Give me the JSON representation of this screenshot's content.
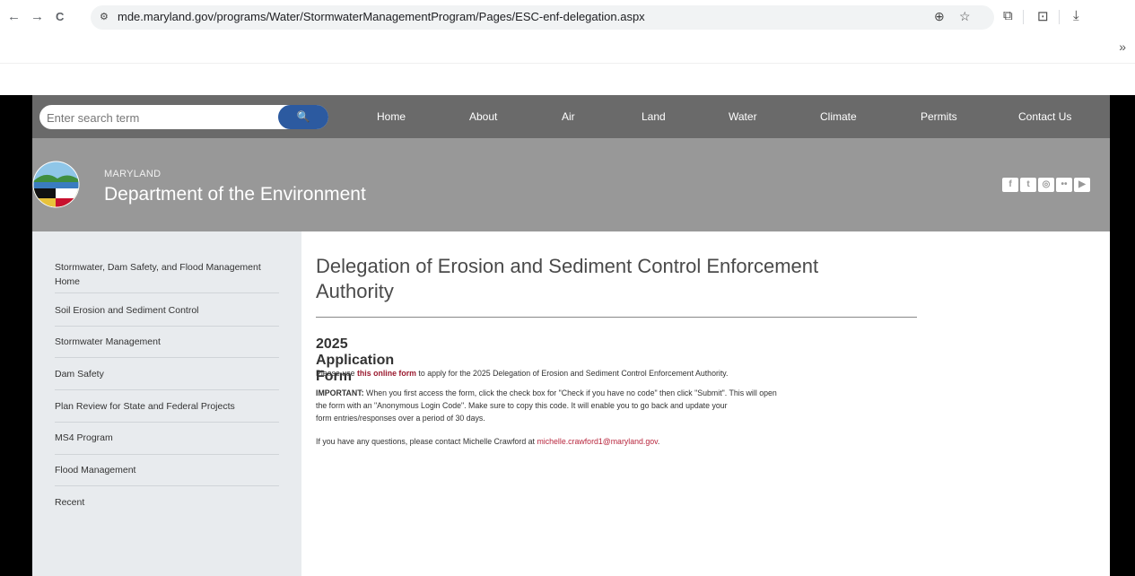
{
  "browser": {
    "url": "mde.maryland.gov/programs/Water/StormwaterManagementProgram/Pages/ESC-enf-delegation.aspx",
    "back_icon": "←",
    "forward_icon": "→",
    "reload_icon": "C",
    "site_info_icon": "⚙",
    "zoom_icon": "⊕",
    "star_icon": "☆",
    "extensions_icon": "⧉",
    "reading_icon": "⊡",
    "download_icon": "⤓",
    "bookmarks_chevron": "»"
  },
  "site_nav": {
    "search_placeholder": "Enter search term",
    "search_icon": "🔍",
    "links": [
      "Home",
      "About",
      "Air",
      "Land",
      "Water",
      "Climate",
      "Permits",
      "Contact Us"
    ]
  },
  "banner": {
    "state": "MARYLAND",
    "department": "Department of the Environment",
    "social": [
      "f",
      "t",
      "◎",
      "••",
      "▶"
    ]
  },
  "sidebar": {
    "items": [
      "Stormwater, Dam Safety, and Flood Management Home",
      "Soil Erosion and Sediment Control",
      "Stormwater Management",
      "Dam Safety",
      "Plan Review for State and Federal Projects",
      "MS4 Program",
      "Flood Management",
      "Recent"
    ]
  },
  "main": {
    "title": "Delegation of Erosion and Sediment Control Enforcement Authority",
    "subtitle": "2025 Application Form",
    "p1_before": "Please use ",
    "p1_link": "this online form",
    "p1_after": " to apply for the 2025 Delegation of Erosion and Sediment Control Enforcement Authority.",
    "important_label": "IMPORTANT:",
    "important_line1": " When you first access the form, click the check box for \"Check if you have no code\" then click \"Submit\".  This will open",
    "important_line2": "the form with an \"Anonymous Login Code\".  Make sure to copy this code.  It will enable you to go back and update your",
    "important_line3": "form entries/responses over a period of 30 days.",
    "contact_before": "If you have any questions, please contact Michelle Crawford at ",
    "contact_email": "michelle.crawford1@maryland.gov",
    "contact_after": "."
  }
}
